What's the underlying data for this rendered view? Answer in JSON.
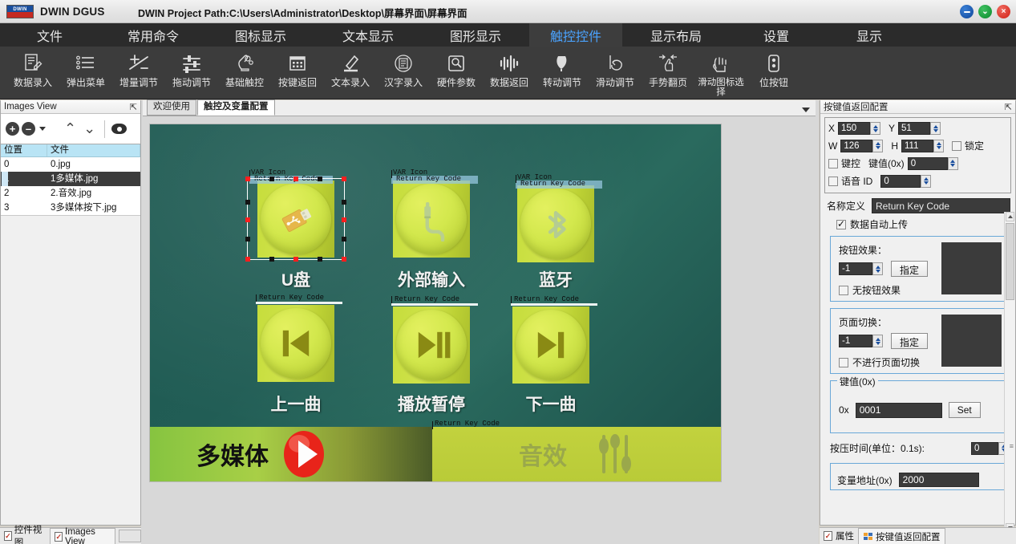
{
  "window": {
    "app_name": "DWIN DGUS",
    "logo_text": "DWIN",
    "project_path": "DWIN Project Path:C:\\Users\\Administrator\\Desktop\\屏幕界面\\屏幕界面",
    "controls": {
      "minimize": "–",
      "maximize": "⌄",
      "close": "×"
    }
  },
  "menu": {
    "items": [
      {
        "label": "文件",
        "active": false
      },
      {
        "label": "常用命令",
        "active": false
      },
      {
        "label": "图标显示",
        "active": false
      },
      {
        "label": "文本显示",
        "active": false
      },
      {
        "label": "图形显示",
        "active": false
      },
      {
        "label": "触控控件",
        "active": true
      },
      {
        "label": "显示布局",
        "active": false
      },
      {
        "label": "设置",
        "active": false
      },
      {
        "label": "显示",
        "active": false
      }
    ]
  },
  "ribbon": {
    "tools": [
      {
        "label": "数据录入",
        "icon": "data-entry-icon"
      },
      {
        "label": "弹出菜单",
        "icon": "popup-menu-icon"
      },
      {
        "label": "增量调节",
        "icon": "increment-adjust-icon"
      },
      {
        "label": "拖动调节",
        "icon": "drag-adjust-icon"
      },
      {
        "label": "基础触控",
        "icon": "basic-touch-icon"
      },
      {
        "label": "按键返回",
        "icon": "return-key-icon"
      },
      {
        "label": "文本录入",
        "icon": "text-entry-icon"
      },
      {
        "label": "汉字录入",
        "icon": "chinese-entry-icon"
      },
      {
        "label": "硬件参数",
        "icon": "hardware-param-icon"
      },
      {
        "label": "数据返回",
        "icon": "data-return-icon"
      },
      {
        "label": "转动调节",
        "icon": "rotate-adjust-icon"
      },
      {
        "label": "滑动调节",
        "icon": "slide-adjust-icon"
      },
      {
        "label": "手势翻页",
        "icon": "gesture-page-icon"
      },
      {
        "label": "滑动图标选择",
        "icon": "slide-icon-select-icon"
      },
      {
        "label": "位按钮",
        "icon": "bit-button-icon"
      }
    ]
  },
  "images_view": {
    "title": "Images View",
    "pin": "⇱",
    "toolbar": {
      "add": "+",
      "remove": "–",
      "move_up": "⌃",
      "move_down": "⌄",
      "preview": "eye-icon"
    },
    "columns": [
      "位置",
      "文件"
    ],
    "rows": [
      {
        "pos": "0",
        "file": "0.jpg",
        "selected": false
      },
      {
        "pos": "1",
        "file": "1多媒体.jpg",
        "selected": true
      },
      {
        "pos": "2",
        "file": "2.音效.jpg",
        "selected": false
      },
      {
        "pos": "3",
        "file": "3多媒体按下.jpg",
        "selected": false
      }
    ],
    "bottom_tabs": [
      {
        "label": "控件视图",
        "active": false
      },
      {
        "label": "Images View",
        "active": true
      }
    ]
  },
  "editor": {
    "tabs": [
      {
        "label": "欢迎使用",
        "active": false
      },
      {
        "label": "触控及变量配置",
        "active": true
      }
    ],
    "canvas": {
      "widgets": [
        {
          "caption": "U盘",
          "icon": "usb-icon",
          "tags": [
            "VAR Icon",
            "Return Key Code"
          ],
          "selected": true
        },
        {
          "caption": "外部输入",
          "icon": "aux-input-icon",
          "tags": [
            "VAR Icon",
            "Return Key Code"
          ],
          "selected": false
        },
        {
          "caption": "蓝牙",
          "icon": "bluetooth-icon",
          "tags": [
            "VAR Icon",
            "Return Key Code"
          ],
          "selected": false
        },
        {
          "caption": "上一曲",
          "icon": "previous-track-icon",
          "tags": [
            "Return Key Code"
          ],
          "selected": false
        },
        {
          "caption": "播放暂停",
          "icon": "play-pause-icon",
          "tags": [
            "Return Key Code"
          ],
          "selected": false
        },
        {
          "caption": "下一曲",
          "icon": "next-track-icon",
          "tags": [
            "Return Key Code"
          ],
          "selected": false
        }
      ],
      "bottom_bar": {
        "left_label": "多媒体",
        "left_icon": "play-circle-icon",
        "right_label": "音效",
        "right_icon": "equalizer-icon",
        "right_tag": "Return Key Code"
      }
    }
  },
  "properties": {
    "title": "按键值返回配置",
    "pin": "⇱",
    "geometry": {
      "x_label": "X",
      "x_value": "150",
      "y_label": "Y",
      "y_value": "51",
      "w_label": "W",
      "w_value": "126",
      "h_label": "H",
      "h_value": "111",
      "lock_label": "锁定",
      "lock_checked": false
    },
    "keycontrol": {
      "keycontrol_label": "键控",
      "keycontrol_checked": false,
      "keyvalue_label": "键值(0x)",
      "keyvalue_value": "0",
      "voice_label": "语音 ID",
      "voice_checked": false,
      "voice_value": "0"
    },
    "name": {
      "label": "名称定义",
      "value": "Return Key Code"
    },
    "auto_upload": {
      "label": "数据自动上传",
      "checked": true
    },
    "button_effect": {
      "title": "按钮效果：",
      "value": "-1",
      "assign_label": "指定",
      "no_effect_label": "无按钮效果",
      "no_effect_checked": false
    },
    "page_switch": {
      "title": "页面切换：",
      "value": "-1",
      "assign_label": "指定",
      "no_switch_label": "不进行页面切换",
      "no_switch_checked": false
    },
    "key_value": {
      "legend": "键值(0x)",
      "prefix": "0x",
      "value": "0001",
      "set_label": "Set"
    },
    "press_time": {
      "label": "按压时间(单位：0.1s):",
      "value": "0"
    },
    "partial": {
      "label": "变量地址(0x)",
      "value": "2000"
    },
    "bottom_tabs": [
      {
        "label": "属性",
        "active": false
      },
      {
        "label": "按键值返回配置",
        "active": true
      }
    ]
  },
  "colors": {
    "menu_active": "#4aa3ff",
    "ribbon_bg": "#3c3c3c",
    "canvas_bg": "#215d55",
    "tile_green": "#c6dd3c",
    "select_handle_red": "#ff1e1e",
    "select_handle_black": "#141414"
  }
}
